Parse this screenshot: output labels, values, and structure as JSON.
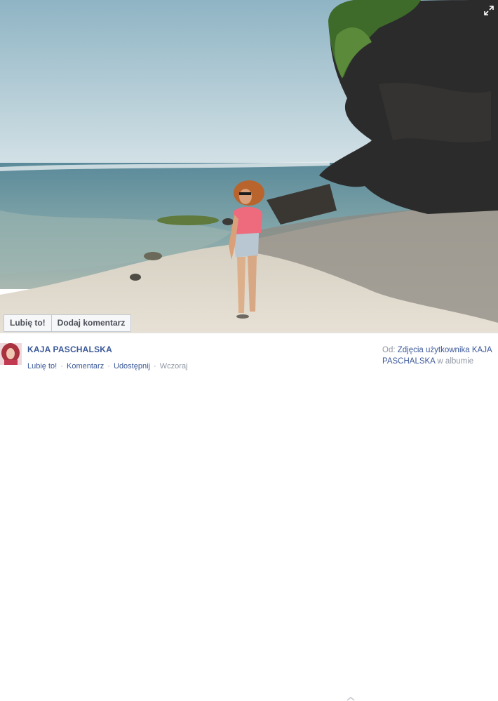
{
  "photo": {
    "like_button": "Lubię to!",
    "comment_button": "Dodaj komentarz",
    "expand_icon": "expand-icon"
  },
  "post": {
    "author": "KAJA PASCHALSKA",
    "actions": {
      "like": "Lubię to!",
      "comment": "Komentarz",
      "share": "Udostępnij",
      "time": "Wczoraj",
      "separator": "·"
    },
    "source": {
      "prefix": "Od:",
      "album_link": "Zdjęcia użytkownika KAJA PASCHALSKA",
      "suffix": "w albumie"
    }
  },
  "colors": {
    "link": "#3b5998",
    "muted": "#9197a3",
    "button_bg": "#f6f7f9",
    "button_text": "#4b4f56"
  }
}
